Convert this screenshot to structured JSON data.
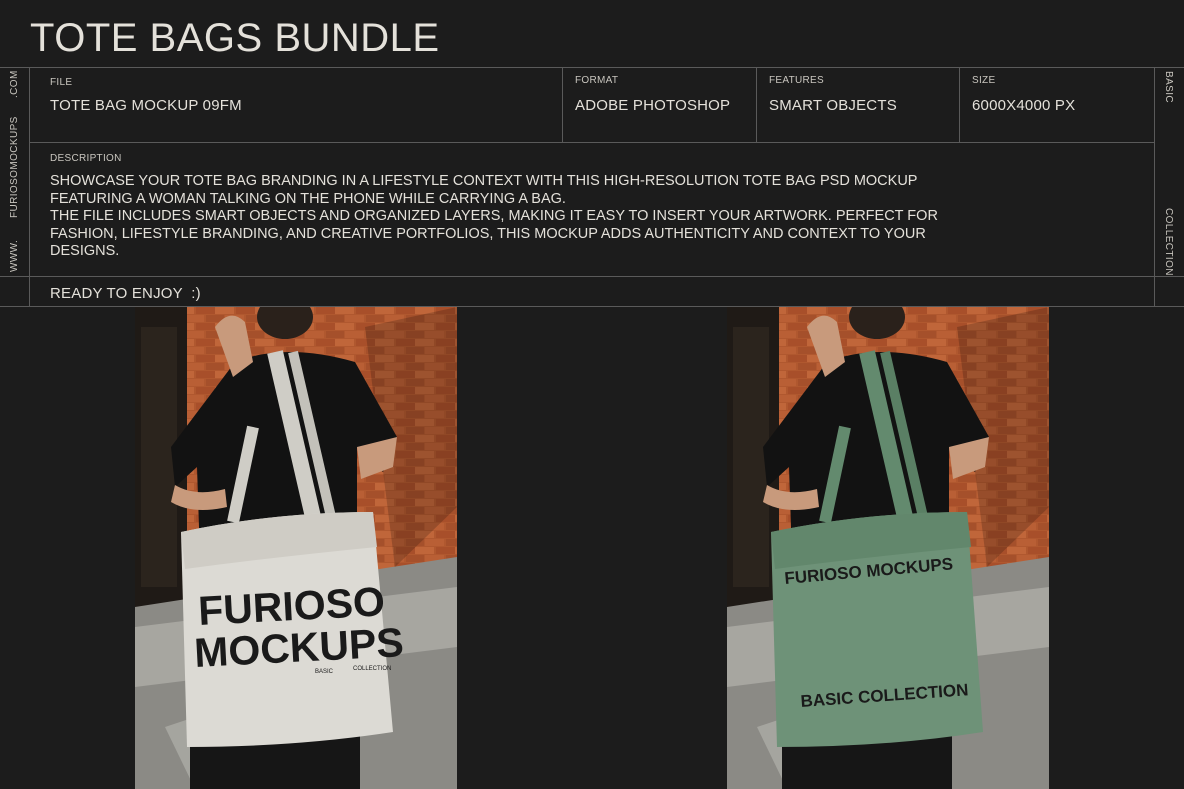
{
  "header": {
    "title": "TOTE BAGS BUNDLE"
  },
  "side": {
    "left_top": ".COM",
    "left_mid": "FURIOSOMOCKUPS",
    "left_bottom": "WWW.",
    "right_top": "BASIC",
    "right_bottom": "COLLECTION"
  },
  "specs": {
    "file_label": "FILE",
    "file_value": "TOTE BAG MOCKUP 09FM",
    "format_label": "FORMAT",
    "format_value": "ADOBE PHOTOSHOP",
    "features_label": "FEATURES",
    "features_value": "SMART OBJECTS",
    "size_label": "SIZE",
    "size_value": "6000X4000 PX"
  },
  "description": {
    "label": "DESCRIPTION",
    "paragraph_1": "SHOWCASE YOUR TOTE BAG BRANDING IN A LIFESTYLE CONTEXT WITH THIS HIGH-RESOLUTION TOTE BAG PSD MOCKUP FEATURING A WOMAN TALKING ON THE PHONE WHILE CARRYING A BAG.",
    "paragraph_2": "THE FILE INCLUDES SMART OBJECTS AND ORGANIZED LAYERS, MAKING IT EASY TO INSERT YOUR ARTWORK. PERFECT FOR FASHION, LIFESTYLE BRANDING, AND CREATIVE PORTFOLIOS, THIS MOCKUP ADDS AUTHENTICITY AND CONTEXT TO YOUR DESIGNS."
  },
  "footer": {
    "ready": "READY TO ENJOY  :)"
  },
  "mockups": [
    {
      "bag_color": "#dcdad4",
      "handle_color": "#cfcdc6",
      "print_line_1": "FURIOSO",
      "print_line_2": "MOCKUPS",
      "small_1": "BASIC",
      "small_2": "COLLECTION"
    },
    {
      "bag_color": "#6e9278",
      "handle_color": "#638a6e",
      "print_line_1": "FURIOSO MOCKUPS",
      "print_line_2": "BASIC COLLECTION"
    }
  ],
  "colors": {
    "background": "#1c1c1c",
    "lines": "#5a5a5a",
    "text": "#e4e1da",
    "brick": "#b0582f"
  }
}
